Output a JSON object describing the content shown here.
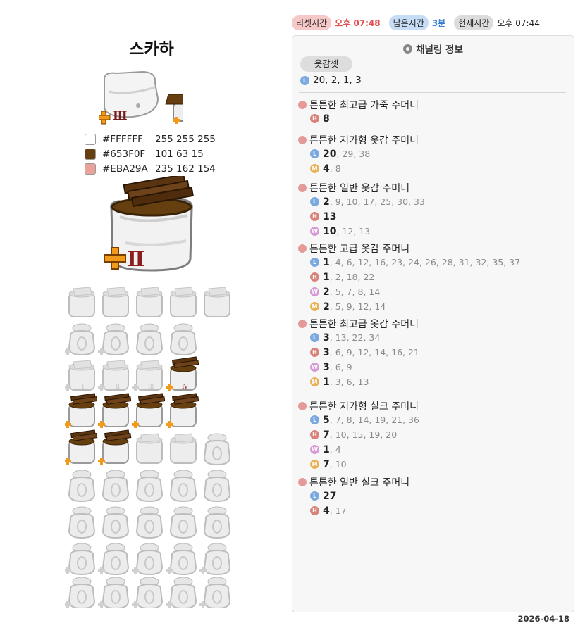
{
  "character": {
    "name": "스카하"
  },
  "colors": [
    {
      "hex": "#FFFFFF",
      "rgb": "255 255 255",
      "swatch": "#FFFFFF"
    },
    {
      "hex": "#653F0F",
      "rgb": "101 63 15",
      "swatch": "#653F0F"
    },
    {
      "hex": "#EBA29A",
      "rgb": "235 162 154",
      "swatch": "#EBA29A"
    }
  ],
  "time": {
    "reset_label": "리셋시간",
    "reset_value": "오후 07:48",
    "remaining_label": "남은시간",
    "remaining_value": "3분",
    "current_label": "현재시간",
    "current_value": "오후 07:44"
  },
  "panel": {
    "title": "채널링 정보",
    "tag": "옷감셋",
    "level_line": "20, 2, 1, 3"
  },
  "items": [
    {
      "name": "튼튼한 최고급 가죽 주머니",
      "rows": [
        {
          "t": "H",
          "first": "8",
          "rest": ""
        }
      ]
    },
    {
      "name": "튼튼한 저가형 옷감 주머니",
      "rows": [
        {
          "t": "L",
          "first": "20",
          "rest": ", 29, 38"
        },
        {
          "t": "M",
          "first": "4",
          "rest": ", 8"
        }
      ]
    },
    {
      "name": "튼튼한 일반 옷감 주머니",
      "rows": [
        {
          "t": "L",
          "first": "2",
          "rest": ", 9, 10, 17, 25, 30, 33"
        },
        {
          "t": "H",
          "first": "13",
          "rest": ""
        },
        {
          "t": "W",
          "first": "10",
          "rest": ", 12, 13"
        }
      ]
    },
    {
      "name": "튼튼한 고급 옷감 주머니",
      "rows": [
        {
          "t": "L",
          "first": "1",
          "rest": ", 4, 6, 12, 16, 23, 24, 26, 28, 31, 32, 35, 37"
        },
        {
          "t": "H",
          "first": "1",
          "rest": ", 2, 18, 22"
        },
        {
          "t": "W",
          "first": "2",
          "rest": ", 5, 7, 8, 14"
        },
        {
          "t": "M",
          "first": "2",
          "rest": ", 5, 9, 12, 14"
        }
      ]
    },
    {
      "name": "튼튼한 최고급 옷감 주머니",
      "rows": [
        {
          "t": "L",
          "first": "3",
          "rest": ", 13, 22, 34"
        },
        {
          "t": "H",
          "first": "3",
          "rest": ", 6, 9, 12, 14, 16, 21"
        },
        {
          "t": "W",
          "first": "3",
          "rest": ", 6, 9"
        },
        {
          "t": "M",
          "first": "1",
          "rest": ", 3, 6, 13"
        }
      ]
    },
    {
      "name": "튼튼한 저가형 실크 주머니",
      "rows": [
        {
          "t": "L",
          "first": "5",
          "rest": ", 7, 8, 14, 19, 21, 36"
        },
        {
          "t": "H",
          "first": "7",
          "rest": ", 10, 15, 19, 20"
        },
        {
          "t": "W",
          "first": "1",
          "rest": ", 4"
        },
        {
          "t": "M",
          "first": "7",
          "rest": ", 10"
        }
      ]
    },
    {
      "name": "튼튼한 일반 실크 주머니",
      "rows": [
        {
          "t": "L",
          "first": "27",
          "rest": ""
        },
        {
          "t": "H",
          "first": "4",
          "rest": ", 17"
        }
      ]
    }
  ],
  "footer": {
    "date": "2026-04-18"
  }
}
